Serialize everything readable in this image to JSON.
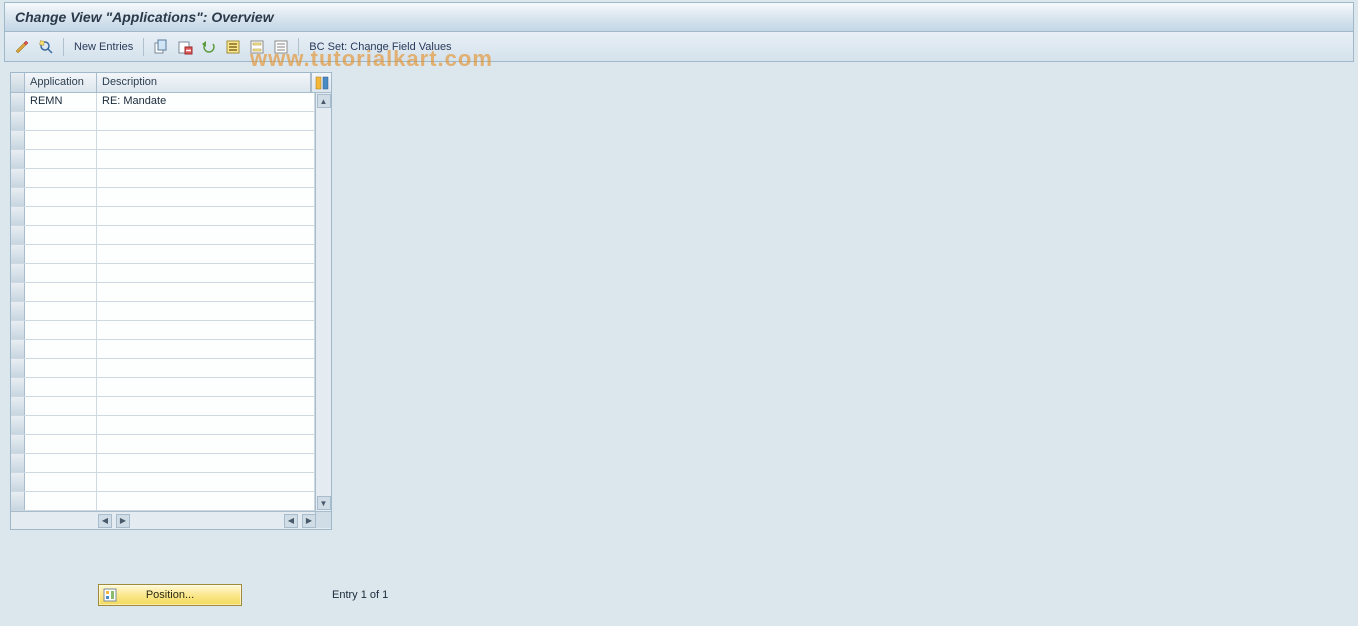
{
  "title": "Change View \"Applications\": Overview",
  "toolbar": {
    "new_entries": "New Entries",
    "bc_set": "BC Set: Change Field Values"
  },
  "watermark": "www.tutorialkart.com",
  "table": {
    "columns": {
      "application": "Application",
      "description": "Description"
    },
    "rows": [
      {
        "application": "REMN",
        "description": "RE: Mandate"
      }
    ],
    "empty_row_count": 21
  },
  "footer": {
    "position_label": "Position...",
    "entry_status": "Entry 1 of 1"
  }
}
